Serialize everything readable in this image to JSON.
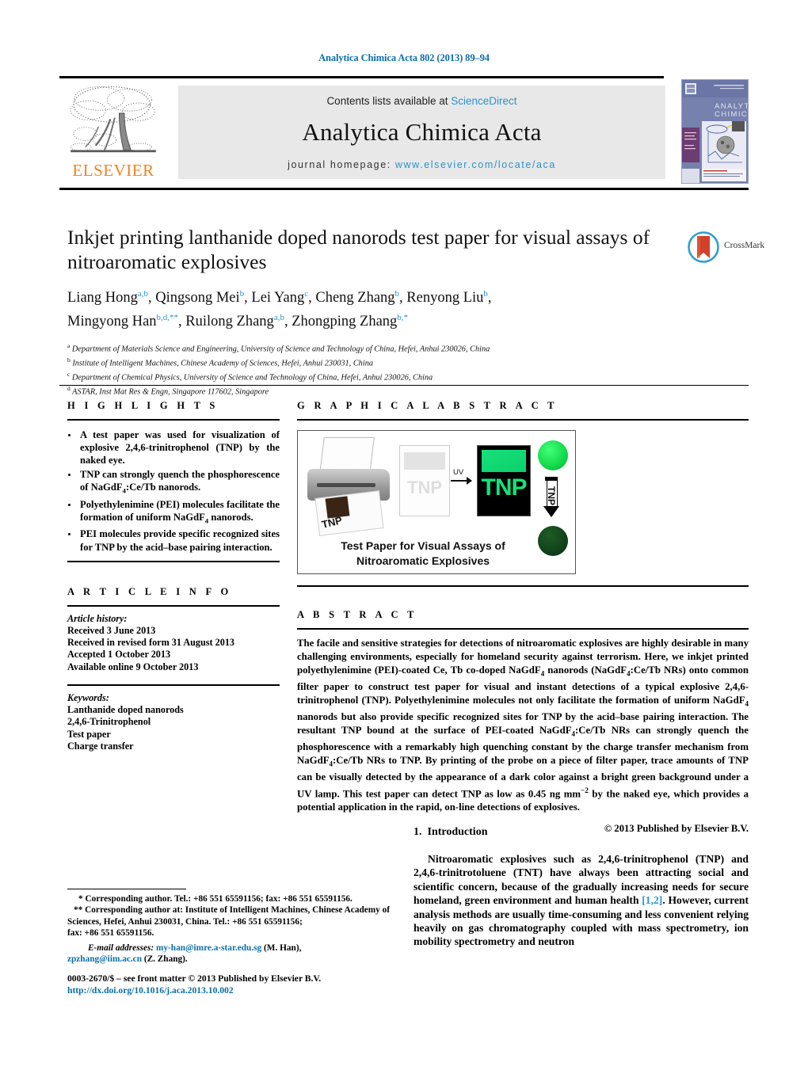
{
  "running_head": "Analytica Chimica Acta 802 (2013) 89–94",
  "masthead": {
    "publisher": "ELSEVIER",
    "contents_prefix": "Contents lists available at ",
    "contents_link": "ScienceDirect",
    "journal_title": "Analytica Chimica Acta",
    "homepage_label": "journal homepage:",
    "homepage_url": "www.elsevier.com/locate/aca",
    "cover_title_line1": "ANALYTICA",
    "cover_title_line2": "CHIMICA ACTA"
  },
  "article": {
    "title": "Inkjet printing lanthanide doped nanorods test paper for visual assays of nitroaromatic explosives",
    "crossmark_label": "CrossMark",
    "authors_line1_parts": [
      {
        "name": "Liang Hong",
        "sup": "a,b"
      },
      {
        "name": "Qingsong Mei",
        "sup": "b"
      },
      {
        "name": "Lei Yang",
        "sup": "c"
      },
      {
        "name": "Cheng Zhang",
        "sup": "b"
      },
      {
        "name": "Renyong Liu",
        "sup": "b"
      }
    ],
    "authors_line2_parts": [
      {
        "name": "Mingyong Han",
        "sup": "b,d,**"
      },
      {
        "name": "Ruilong Zhang",
        "sup": "a,b"
      },
      {
        "name": "Zhongping Zhang",
        "sup": "b,*"
      }
    ],
    "affiliations": [
      {
        "marker": "a",
        "text": "Department of Materials Science and Engineering, University of Science and Technology of China, Hefei, Anhui 230026, China"
      },
      {
        "marker": "b",
        "text": "Institute of Intelligent Machines, Chinese Academy of Sciences, Hefei, Anhui 230031, China"
      },
      {
        "marker": "c",
        "text": "Department of Chemical Physics, University of Science and Technology of China, Hefei, Anhui 230026, China"
      },
      {
        "marker": "d",
        "text": "ASTAR, Inst Mat Res & Engn, Singapore 117602, Singapore"
      }
    ]
  },
  "highlights": {
    "heading": "H I G H L I G H T S",
    "items": [
      "A test paper was used for visualization of explosive 2,4,6-trinitrophenol (TNP) by the naked eye.",
      "TNP can strongly quench the phosphorescence of NaGdF4:Ce/Tb nanorods.",
      "Polyethylenimine (PEI) molecules facilitate the formation of uniform NaGdF4 nanorods.",
      "PEI molecules provide specific recognized sites for TNP by the acid–base pairing interaction."
    ]
  },
  "graphical_abstract": {
    "heading": "G R A P H I C A L   A B S T R A C T",
    "caption_line1": "Test Paper for Visual Assays of",
    "caption_line2": "Nitroaromatic Explosives",
    "printer_label": "TNP",
    "blank_paper_label": "TNP",
    "uv_label": "UV",
    "uv_paper_label": "TNP",
    "gradient_arrow_label": "TNP",
    "colors": {
      "bright_green": "#13d94b",
      "dark_green": "#11421a",
      "uv_paper_text": "#12e37b"
    }
  },
  "article_info": {
    "heading": "A R T I C L E   I N F O",
    "history_label": "Article history:",
    "history": [
      "Received 3 June 2013",
      "Received in revised form 31 August 2013",
      "Accepted 1 October 2013",
      "Available online 9 October 2013"
    ],
    "keywords_label": "Keywords:",
    "keywords": [
      "Lanthanide doped nanorods",
      "2,4,6-Trinitrophenol",
      "Test paper",
      "Charge transfer"
    ]
  },
  "abstract": {
    "heading": "A B S T R A C T",
    "copyright": "© 2013 Published by Elsevier B.V."
  },
  "introduction": {
    "number": "1.",
    "heading": "Introduction",
    "citation": "[1,2]"
  },
  "footnotes": {
    "corresponding_1": "* Corresponding author. Tel.: +86 551 65591156; fax: +86 551 65591156.",
    "corresponding_2": "** Corresponding author at: Institute of Intelligent Machines, Chinese Academy of Sciences, Hefei, Anhui 230031, China. Tel.: +86 551 65591156;",
    "corresponding_2b": "fax: +86 551 65591156.",
    "email_label": "E-mail addresses:",
    "email_1": "my-han@imre.a-star.edu.sg",
    "email_1_owner": "(M. Han),",
    "email_2": "zpzhang@iim.ac.cn",
    "email_2_owner": "(Z. Zhang).",
    "imprint_line": "0003-2670/$ – see front matter © 2013 Published by Elsevier B.V.",
    "doi": "http://dx.doi.org/10.1016/j.aca.2013.10.002"
  }
}
